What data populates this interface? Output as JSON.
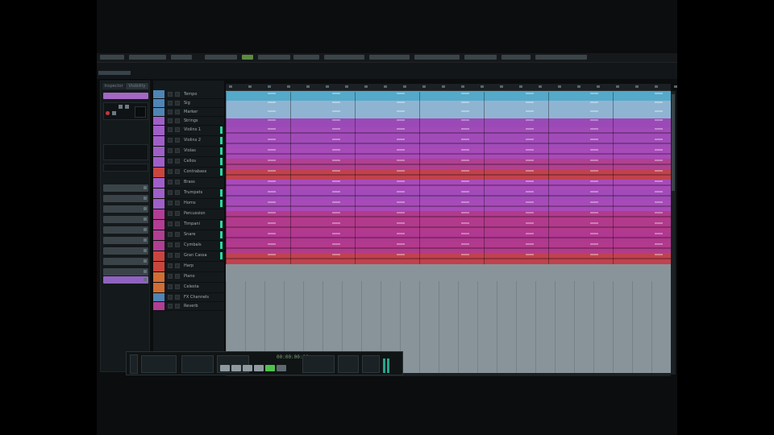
{
  "colors": {
    "background": "#0b0d0e",
    "panel": "#14191b",
    "empty_lane": "#889499",
    "cyan": "#55a9c9",
    "light_blue": "#8fb4d2",
    "purple": "#9b49b6",
    "magenta": "#b23a8c",
    "red": "#c0424e",
    "orange_red": "#c94d37",
    "orange_part": "#d7813a",
    "meter_green": "#2bd6a1",
    "transport_green": "#4fc24d"
  },
  "icons": {
    "record": "record-icon",
    "monitor": "speaker-icon",
    "mute": "mute-icon",
    "solo": "solo-icon",
    "play": "play-icon",
    "stop": "stop-icon",
    "cycle": "cycle-icon"
  },
  "tracks": [
    {
      "name": "Tempo",
      "color": "#4e85b5",
      "meter": false
    },
    {
      "name": "Sig",
      "color": "#4e85b5",
      "meter": false
    },
    {
      "name": "Marker",
      "color": "#4e85b5",
      "meter": false
    },
    {
      "name": "Strings",
      "color": "#a05fc8",
      "meter": false
    },
    {
      "name": "Violins 1",
      "color": "#a05fc8",
      "meter": true
    },
    {
      "name": "Violins 2",
      "color": "#a05fc8",
      "meter": true
    },
    {
      "name": "Violas",
      "color": "#a05fc8",
      "meter": true
    },
    {
      "name": "Cellos",
      "color": "#a05fc8",
      "meter": true
    },
    {
      "name": "Contrabass",
      "color": "#c9463f",
      "meter": true
    },
    {
      "name": "Brass",
      "color": "#a05fc8",
      "meter": false
    },
    {
      "name": "Trumpets",
      "color": "#a05fc8",
      "meter": true
    },
    {
      "name": "Horns",
      "color": "#a05fc8",
      "meter": true
    },
    {
      "name": "Percussion",
      "color": "#b13e93",
      "meter": false
    },
    {
      "name": "Timpani",
      "color": "#b13e93",
      "meter": true
    },
    {
      "name": "Snare",
      "color": "#b13e93",
      "meter": true
    },
    {
      "name": "Cymbals",
      "color": "#b13e93",
      "meter": true
    },
    {
      "name": "Gran Cassa",
      "color": "#c9463f",
      "meter": true
    },
    {
      "name": "Harp",
      "color": "#c9463f",
      "meter": false
    },
    {
      "name": "Piano",
      "color": "#d26d36",
      "meter": false
    },
    {
      "name": "Celesta",
      "color": "#d26d36",
      "meter": false
    },
    {
      "name": "FX Channels",
      "color": "#4e85b5",
      "meter": false
    },
    {
      "name": "Reverb",
      "color": "#b13e93",
      "meter": false
    }
  ],
  "inspector": {
    "tab_1": "Inspector",
    "tab_2": "Visibility"
  },
  "transport": {
    "time": "00:00:00:00"
  }
}
